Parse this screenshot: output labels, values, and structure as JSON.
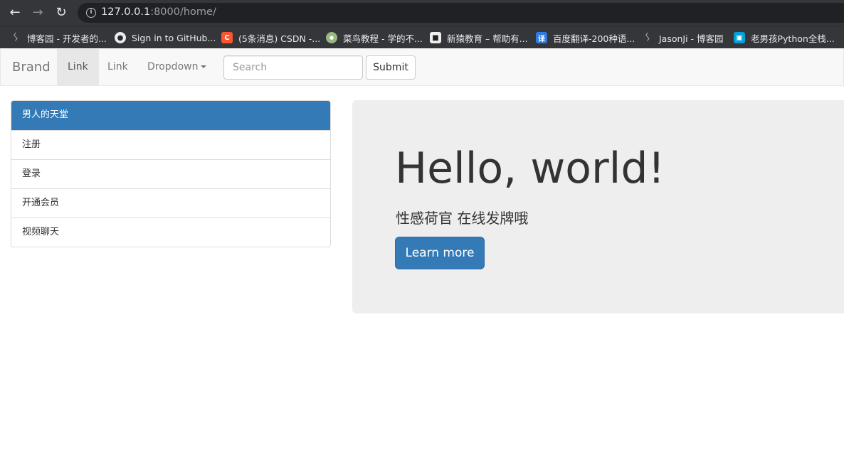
{
  "browser": {
    "url_host": "127.0.0.1",
    "url_rest": ":8000/home/",
    "bookmarks": [
      {
        "label": "博客园 - 开发者的...",
        "icon": "cnblogs-icon",
        "color": "#555555"
      },
      {
        "label": "Sign in to GitHub...",
        "icon": "github-icon",
        "color": "#24292e"
      },
      {
        "label": "(5条消息) CSDN -...",
        "icon": "csdn-icon",
        "color": "#fc5531"
      },
      {
        "label": "菜鸟教程 - 学的不...",
        "icon": "runoob-icon",
        "color": "#96b97d"
      },
      {
        "label": "新猿教育 – 帮助有...",
        "icon": "xinyuan-icon",
        "color": "#eeeeee"
      },
      {
        "label": "百度翻译-200种语...",
        "icon": "baidu-translate-icon",
        "color": "#2d7de0"
      },
      {
        "label": "JasonJi - 博客园",
        "icon": "cnblogs-icon",
        "color": "#555555"
      },
      {
        "label": "老男孩Python全栈...",
        "icon": "bilibili-icon",
        "color": "#00a1d6"
      }
    ]
  },
  "navbar": {
    "brand": "Brand",
    "links": [
      "Link",
      "Link"
    ],
    "dropdown": "Dropdown",
    "search_placeholder": "Search",
    "submit": "Submit"
  },
  "sidebar": {
    "items": [
      "男人的天堂",
      "注册",
      "登录",
      "开通会员",
      "视频聊天"
    ]
  },
  "jumbotron": {
    "title": "Hello, world!",
    "subtitle": "性感荷官 在线发牌哦",
    "button": "Learn more"
  }
}
